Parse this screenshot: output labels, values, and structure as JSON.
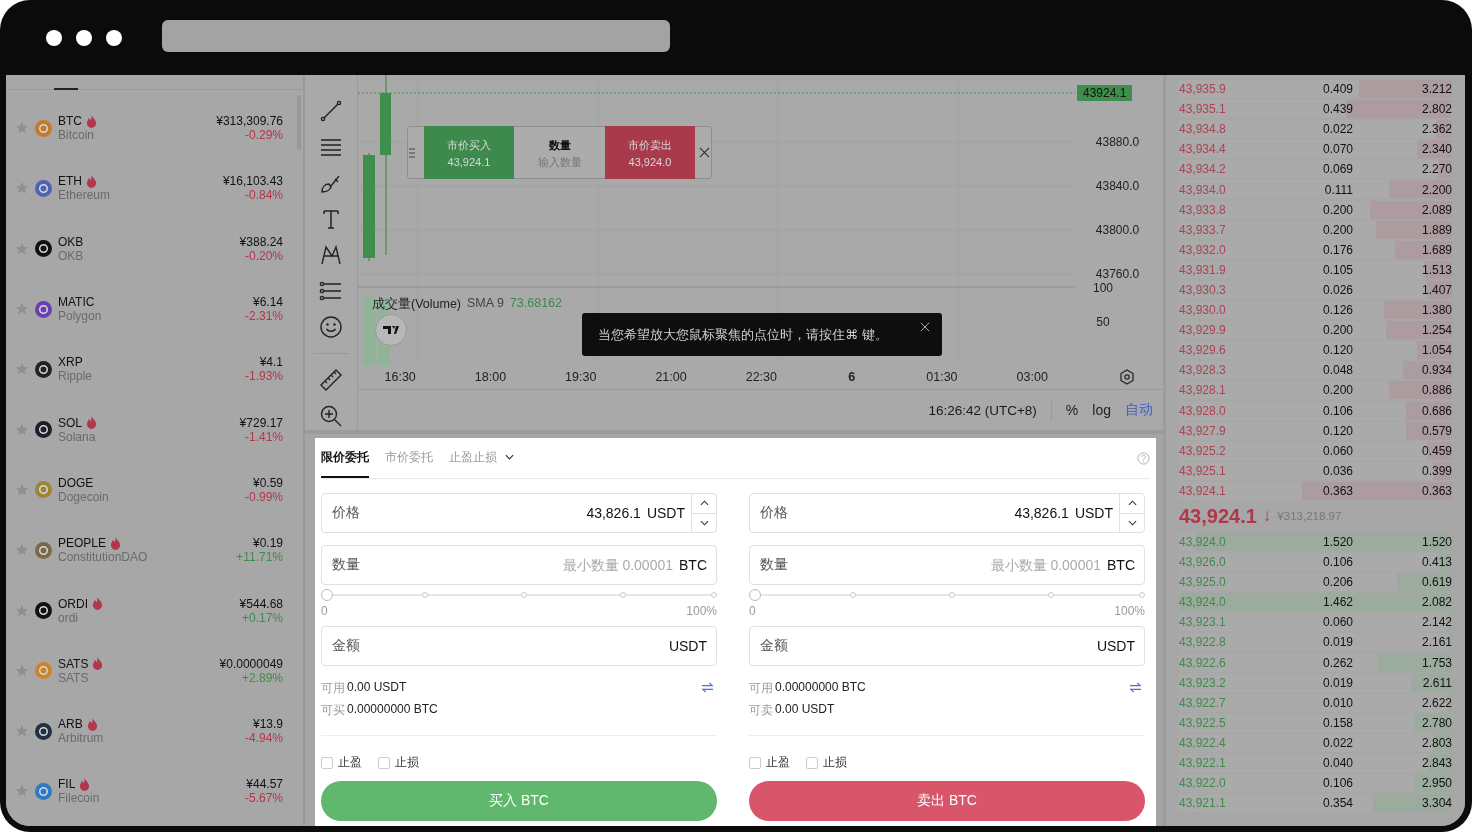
{
  "markets": [
    {
      "symbol": "BTC",
      "name": "Bitcoin",
      "hot": true,
      "color": "#c27b2e",
      "price": "¥313,309.76",
      "change": "-0.29%",
      "rising": false
    },
    {
      "symbol": "ETH",
      "name": "Ethereum",
      "hot": true,
      "color": "#4e62b6",
      "price": "¥16,103.43",
      "change": "-0.84%",
      "rising": false
    },
    {
      "symbol": "OKB",
      "name": "OKB",
      "hot": false,
      "color": "#111111",
      "price": "¥388.24",
      "change": "-0.20%",
      "rising": false
    },
    {
      "symbol": "MATIC",
      "name": "Polygon",
      "hot": false,
      "color": "#6a3fb5",
      "price": "¥6.14",
      "change": "-2.31%",
      "rising": false
    },
    {
      "symbol": "XRP",
      "name": "Ripple",
      "hot": false,
      "color": "#222222",
      "price": "¥4.1",
      "change": "-1.93%",
      "rising": false
    },
    {
      "symbol": "SOL",
      "name": "Solana",
      "hot": true,
      "color": "#1e1e2a",
      "price": "¥729.17",
      "change": "-1.41%",
      "rising": false
    },
    {
      "symbol": "DOGE",
      "name": "Dogecoin",
      "hot": false,
      "color": "#9c8636",
      "price": "¥0.59",
      "change": "-0.99%",
      "rising": false
    },
    {
      "symbol": "PEOPLE",
      "name": "ConstitutionDAO",
      "hot": true,
      "color": "#7a6a4a",
      "price": "¥0.19",
      "change": "+11.71%",
      "rising": true
    },
    {
      "symbol": "ORDI",
      "name": "ordi",
      "hot": true,
      "color": "#111111",
      "price": "¥544.68",
      "change": "+0.17%",
      "rising": true
    },
    {
      "symbol": "SATS",
      "name": "SATS",
      "hot": true,
      "color": "#c9842e",
      "price": "¥0.0000049",
      "change": "+2.89%",
      "rising": true
    },
    {
      "symbol": "ARB",
      "name": "Arbitrum",
      "hot": true,
      "color": "#22303f",
      "price": "¥13.9",
      "change": "-4.94%",
      "rising": false
    },
    {
      "symbol": "FIL",
      "name": "Filecoin",
      "hot": true,
      "color": "#2e79c8",
      "price": "¥44.57",
      "change": "-5.67%",
      "rising": false
    }
  ],
  "chart": {
    "price_tag": "43924.1",
    "price_ticks": [
      "43880.0",
      "43840.0",
      "43800.0",
      "43760.0"
    ],
    "volume_ticks": [
      "100",
      "50"
    ],
    "volume_label": "成交量(Volume)",
    "sma_label": "SMA 9",
    "sma_value": "73.68162",
    "time_ticks": [
      {
        "label": "16:30",
        "bold": false
      },
      {
        "label": "18:00",
        "bold": false
      },
      {
        "label": "19:30",
        "bold": false
      },
      {
        "label": "21:00",
        "bold": false
      },
      {
        "label": "22:30",
        "bold": false
      },
      {
        "label": "6",
        "bold": true
      },
      {
        "label": "01:30",
        "bold": false
      },
      {
        "label": "03:00",
        "bold": false
      }
    ],
    "timestamp": "16:26:42 (UTC+8)",
    "scale_options": [
      {
        "label": "%",
        "selected": false
      },
      {
        "label": "log",
        "selected": false
      },
      {
        "label": "自动",
        "selected": true
      }
    ]
  },
  "quick_trade": {
    "buy": {
      "label": "市价买入",
      "price": "43,924.1"
    },
    "quantity": {
      "label": "数量",
      "placeholder": "输入数量"
    },
    "sell": {
      "label": "市价卖出",
      "price": "43,924.0"
    }
  },
  "tooltip": {
    "text": "当您希望放大您鼠标聚焦的点位时，请按住⌘ 键。"
  },
  "order_form": {
    "tabs": [
      {
        "label": "限价委托",
        "selected": true,
        "dropdown": false
      },
      {
        "label": "市价委托",
        "selected": false,
        "dropdown": false
      },
      {
        "label": "止盈止损",
        "selected": false,
        "dropdown": true
      }
    ],
    "panels": [
      {
        "kind": "buy",
        "price": {
          "label": "价格",
          "value": "43,826.1",
          "unit": "USDT"
        },
        "quantity": {
          "label": "数量",
          "placeholder": "最小数量 0.00001",
          "unit": "BTC"
        },
        "slider": {
          "level": 0,
          "min_label": "0",
          "max_label": "100%"
        },
        "amount": {
          "label": "金额",
          "unit": "USDT"
        },
        "balances": [
          {
            "label": "可用",
            "value": "0.00 USDT"
          },
          {
            "label": "可买",
            "value": "0.00000000 BTC"
          }
        ],
        "options": [
          {
            "label": "止盈",
            "checked": false
          },
          {
            "label": "止损",
            "checked": false
          }
        ],
        "submit": "买入 BTC"
      },
      {
        "kind": "sell",
        "price": {
          "label": "价格",
          "value": "43,826.1",
          "unit": "USDT"
        },
        "quantity": {
          "label": "数量",
          "placeholder": "最小数量 0.00001",
          "unit": "BTC"
        },
        "slider": {
          "level": 0,
          "min_label": "0",
          "max_label": "100%"
        },
        "amount": {
          "label": "金额",
          "unit": "USDT"
        },
        "balances": [
          {
            "label": "可用",
            "value": "0.00000000 BTC"
          },
          {
            "label": "可卖",
            "value": "0.00 USDT"
          }
        ],
        "options": [
          {
            "label": "止盈",
            "checked": false
          },
          {
            "label": "止损",
            "checked": false
          }
        ],
        "submit": "卖出 BTC"
      }
    ]
  },
  "order_book": {
    "asks": [
      {
        "price": "43,935.9",
        "amount": "0.409",
        "total": "3.212",
        "level": 0.34
      },
      {
        "price": "43,935.1",
        "amount": "0.439",
        "total": "2.802",
        "level": 0.39
      },
      {
        "price": "43,934.8",
        "amount": "0.022",
        "total": "2.362",
        "level": 0.06
      },
      {
        "price": "43,934.4",
        "amount": "0.070",
        "total": "2.340",
        "level": 0.13
      },
      {
        "price": "43,934.2",
        "amount": "0.069",
        "total": "2.270",
        "level": 0.05
      },
      {
        "price": "43,934.0",
        "amount": "0.111",
        "total": "2.200",
        "level": 0.23
      },
      {
        "price": "43,933.8",
        "amount": "0.200",
        "total": "2.089",
        "level": 0.3
      },
      {
        "price": "43,933.7",
        "amount": "0.200",
        "total": "1.889",
        "level": 0.28
      },
      {
        "price": "43,932.0",
        "amount": "0.176",
        "total": "1.689",
        "level": 0.21
      },
      {
        "price": "43,931.9",
        "amount": "0.105",
        "total": "1.513",
        "level": 0.1
      },
      {
        "price": "43,930.3",
        "amount": "0.026",
        "total": "1.407",
        "level": 0.09
      },
      {
        "price": "43,930.0",
        "amount": "0.126",
        "total": "1.380",
        "level": 0.25
      },
      {
        "price": "43,929.9",
        "amount": "0.200",
        "total": "1.254",
        "level": 0.24
      },
      {
        "price": "43,929.6",
        "amount": "0.120",
        "total": "1.054",
        "level": 0.13
      },
      {
        "price": "43,928.3",
        "amount": "0.048",
        "total": "0.934",
        "level": 0.18
      },
      {
        "price": "43,928.1",
        "amount": "0.200",
        "total": "0.886",
        "level": 0.23
      },
      {
        "price": "43,928.0",
        "amount": "0.106",
        "total": "0.686",
        "level": 0.17
      },
      {
        "price": "43,927.9",
        "amount": "0.120",
        "total": "0.579",
        "level": 0.17
      },
      {
        "price": "43,925.2",
        "amount": "0.060",
        "total": "0.459",
        "level": 0.09
      },
      {
        "price": "43,925.1",
        "amount": "0.036",
        "total": "0.399",
        "level": 0.07
      },
      {
        "price": "43,924.1",
        "amount": "0.363",
        "total": "0.363",
        "level": 0.55
      }
    ],
    "last": {
      "price": "43,924.1",
      "arrow": "↓",
      "rising": false,
      "fiat": "¥313,218.97"
    },
    "bids": [
      {
        "price": "43,924.0",
        "amount": "1.520",
        "total": "1.520",
        "level": 0.94
      },
      {
        "price": "43,926.0",
        "amount": "0.106",
        "total": "0.413",
        "level": 0.05
      },
      {
        "price": "43,925.0",
        "amount": "0.206",
        "total": "0.619",
        "level": 0.2
      },
      {
        "price": "43,924.0",
        "amount": "1.462",
        "total": "2.082",
        "level": 1
      },
      {
        "price": "43,923.1",
        "amount": "0.060",
        "total": "2.142",
        "level": 0.02
      },
      {
        "price": "43,922.8",
        "amount": "0.019",
        "total": "2.161",
        "level": 0.01
      },
      {
        "price": "43,922.6",
        "amount": "0.262",
        "total": "1.753",
        "level": 0.27
      },
      {
        "price": "43,923.2",
        "amount": "0.019",
        "total": "2.611",
        "level": 0.15
      },
      {
        "price": "43,922.7",
        "amount": "0.010",
        "total": "2.622",
        "level": 0.02
      },
      {
        "price": "43,922.5",
        "amount": "0.158",
        "total": "2.780",
        "level": 0.14
      },
      {
        "price": "43,922.4",
        "amount": "0.022",
        "total": "2.803",
        "level": 0.07
      },
      {
        "price": "43,922.1",
        "amount": "0.040",
        "total": "2.843",
        "level": 0.09
      },
      {
        "price": "43,922.0",
        "amount": "0.106",
        "total": "2.950",
        "level": 0.14
      },
      {
        "price": "43,921.1",
        "amount": "0.354",
        "total": "3.304",
        "level": 0.29
      }
    ]
  }
}
